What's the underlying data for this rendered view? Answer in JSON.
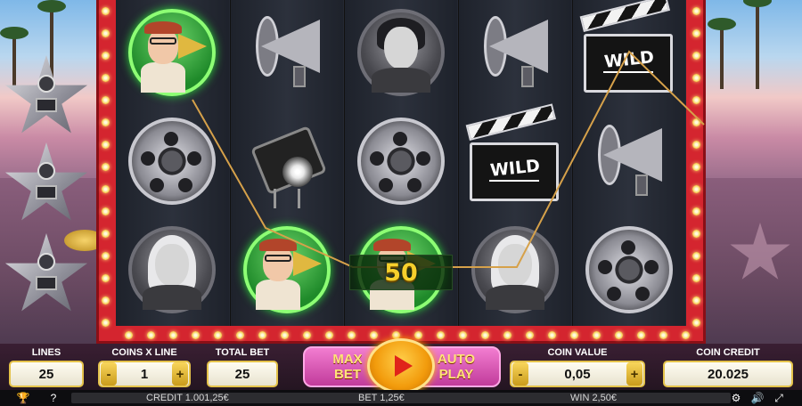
{
  "reels": [
    [
      "director",
      "film",
      "portrait-woman"
    ],
    [
      "megaphone",
      "spotlight",
      "director"
    ],
    [
      "portrait-man",
      "film",
      "director"
    ],
    [
      "megaphone",
      "clapper",
      "portrait-woman"
    ],
    [
      "clapper",
      "megaphone",
      "film"
    ]
  ],
  "wild_label": "WILD",
  "win_amount": "50",
  "controls": {
    "lines_label": "LINES",
    "lines_value": "25",
    "coins_label": "COINS X LINE",
    "coins_value": "1",
    "minus": "-",
    "plus": "+",
    "total_bet_label": "TOTAL BET",
    "total_bet_value": "25",
    "max_bet_line1": "MAX",
    "max_bet_line2": "BET",
    "auto_play_line1": "AUTO",
    "auto_play_line2": "PLAY",
    "coin_value_label": "COIN VALUE",
    "coin_value": "0,05",
    "coin_credit_label": "COIN CREDIT",
    "coin_credit_value": "20.025"
  },
  "status": {
    "credit": "CREDIT 1.001,25€",
    "bet": "BET 1,25€",
    "win": "WIN 2,50€"
  },
  "icons": [
    "trophy-icon",
    "help-icon",
    "settings-icon",
    "sound-icon",
    "fullscreen-icon"
  ],
  "colors": {
    "frame": "#d4252f",
    "bulb": "#f8d35a",
    "payline": "#d6a14a",
    "win_text": "#f6d02c"
  }
}
